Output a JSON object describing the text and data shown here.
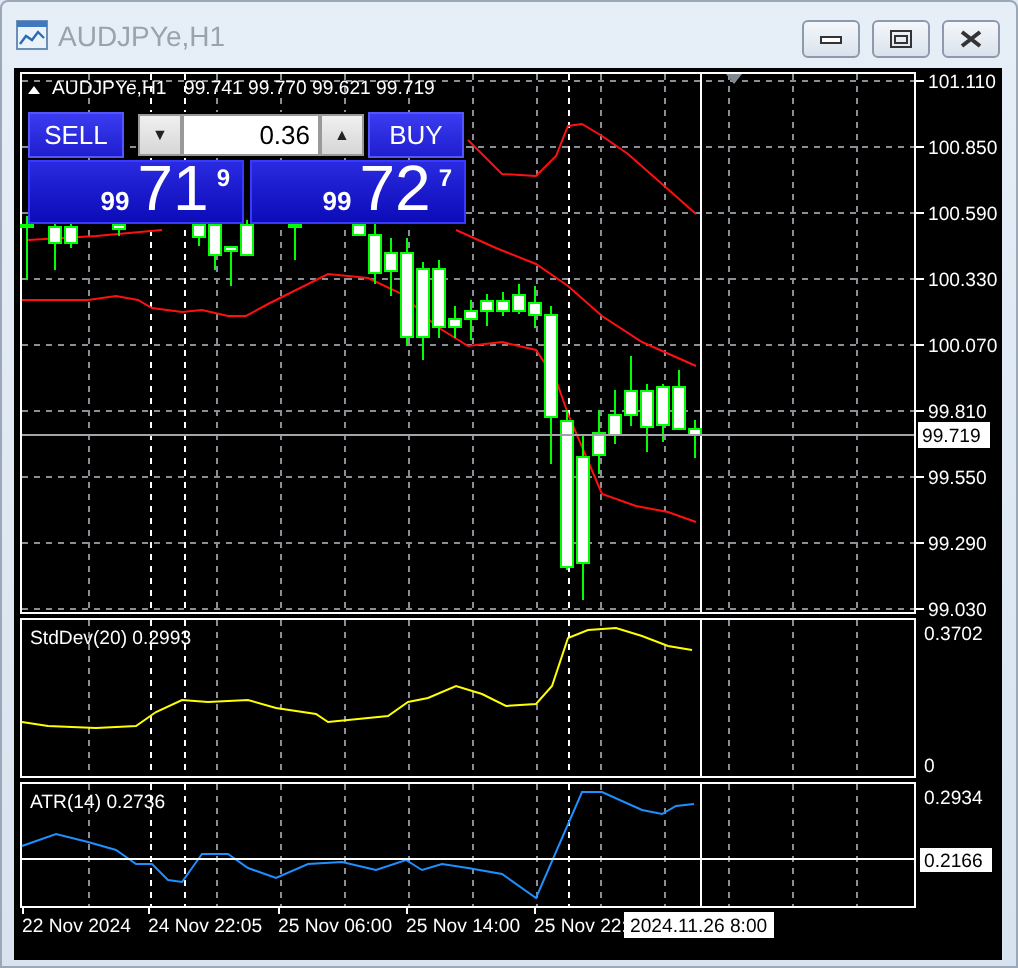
{
  "window": {
    "title": "AUDJPYe,H1"
  },
  "chart": {
    "symbol": "AUDJPYe,H1",
    "ohlc": "99.741 99.770 99.621 99.719",
    "price_axis": [
      "101.110",
      "100.850",
      "100.590",
      "100.330",
      "100.070",
      "99.810",
      "99.550",
      "99.290",
      "99.030"
    ],
    "current_price": "99.719",
    "trade_panel": {
      "sell_label": "SELL",
      "buy_label": "BUY",
      "lot": "0.36",
      "down_arrow": "▼",
      "up_arrow": "▲",
      "bid": {
        "big": "99",
        "pips": "71",
        "point": "9"
      },
      "ask": {
        "big": "99",
        "pips": "72",
        "point": "7"
      }
    },
    "indicators": [
      {
        "kind": "stddev",
        "label": "StdDev(20) 0.2993",
        "axis": [
          "0.3702",
          "0"
        ]
      },
      {
        "kind": "atr",
        "label": "ATR(14) 0.2736",
        "axis": [
          "0.2934"
        ],
        "crosshair_value": "0.2166"
      }
    ],
    "time_axis": [
      "22 Nov 2024",
      "24 Nov 22:05",
      "25 Nov 06:00",
      "25 Nov 14:00",
      "25 Nov 22:"
    ],
    "crosshair_time": "2024.11.26 8:00"
  }
}
